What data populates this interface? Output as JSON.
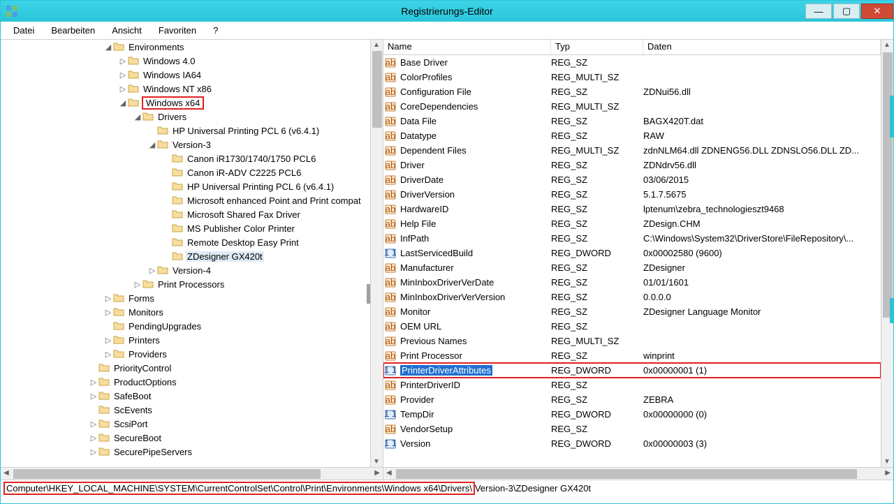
{
  "window": {
    "title": "Registrierungs-Editor"
  },
  "menu": {
    "file": "Datei",
    "edit": "Bearbeiten",
    "view": "Ansicht",
    "favorites": "Favoriten",
    "help": "?"
  },
  "tree": [
    {
      "indent": 7,
      "tw": "◢",
      "label": "Environments"
    },
    {
      "indent": 8,
      "tw": "▷",
      "label": "Windows 4.0"
    },
    {
      "indent": 8,
      "tw": "▷",
      "label": "Windows IA64"
    },
    {
      "indent": 8,
      "tw": "▷",
      "label": "Windows NT x86"
    },
    {
      "indent": 8,
      "tw": "◢",
      "label": "Windows x64",
      "highlight": true
    },
    {
      "indent": 9,
      "tw": "◢",
      "label": "Drivers"
    },
    {
      "indent": 10,
      "tw": "",
      "label": "HP Universal Printing PCL 6 (v6.4.1)"
    },
    {
      "indent": 10,
      "tw": "◢",
      "label": "Version-3"
    },
    {
      "indent": 11,
      "tw": "",
      "label": "Canon iR1730/1740/1750 PCL6"
    },
    {
      "indent": 11,
      "tw": "",
      "label": "Canon iR-ADV C2225 PCL6"
    },
    {
      "indent": 11,
      "tw": "",
      "label": "HP Universal Printing PCL 6 (v6.4.1)"
    },
    {
      "indent": 11,
      "tw": "",
      "label": "Microsoft enhanced Point and Print compat"
    },
    {
      "indent": 11,
      "tw": "",
      "label": "Microsoft Shared Fax Driver"
    },
    {
      "indent": 11,
      "tw": "",
      "label": "MS Publisher Color Printer"
    },
    {
      "indent": 11,
      "tw": "",
      "label": "Remote Desktop Easy Print"
    },
    {
      "indent": 11,
      "tw": "",
      "label": "ZDesigner GX420t",
      "selected": true
    },
    {
      "indent": 10,
      "tw": "▷",
      "label": "Version-4"
    },
    {
      "indent": 9,
      "tw": "▷",
      "label": "Print Processors"
    },
    {
      "indent": 7,
      "tw": "▷",
      "label": "Forms"
    },
    {
      "indent": 7,
      "tw": "▷",
      "label": "Monitors"
    },
    {
      "indent": 7,
      "tw": "",
      "label": "PendingUpgrades"
    },
    {
      "indent": 7,
      "tw": "▷",
      "label": "Printers"
    },
    {
      "indent": 7,
      "tw": "▷",
      "label": "Providers"
    },
    {
      "indent": 6,
      "tw": "",
      "label": "PriorityControl"
    },
    {
      "indent": 6,
      "tw": "▷",
      "label": "ProductOptions"
    },
    {
      "indent": 6,
      "tw": "▷",
      "label": "SafeBoot"
    },
    {
      "indent": 6,
      "tw": "",
      "label": "ScEvents"
    },
    {
      "indent": 6,
      "tw": "▷",
      "label": "ScsiPort"
    },
    {
      "indent": 6,
      "tw": "▷",
      "label": "SecureBoot"
    },
    {
      "indent": 6,
      "tw": "▷",
      "label": "SecurePipeServers"
    }
  ],
  "list": {
    "columns": {
      "name": "Name",
      "type": "Typ",
      "data": "Daten"
    },
    "rows": [
      {
        "icon": "sz",
        "name": "Base Driver",
        "type": "REG_SZ",
        "data": ""
      },
      {
        "icon": "sz",
        "name": "ColorProfiles",
        "type": "REG_MULTI_SZ",
        "data": ""
      },
      {
        "icon": "sz",
        "name": "Configuration File",
        "type": "REG_SZ",
        "data": "ZDNui56.dll"
      },
      {
        "icon": "sz",
        "name": "CoreDependencies",
        "type": "REG_MULTI_SZ",
        "data": ""
      },
      {
        "icon": "sz",
        "name": "Data File",
        "type": "REG_SZ",
        "data": "BAGX420T.dat"
      },
      {
        "icon": "sz",
        "name": "Datatype",
        "type": "REG_SZ",
        "data": "RAW"
      },
      {
        "icon": "sz",
        "name": "Dependent Files",
        "type": "REG_MULTI_SZ",
        "data": "zdnNLM64.dll ZDNENG56.DLL ZDNSLO56.DLL ZD..."
      },
      {
        "icon": "sz",
        "name": "Driver",
        "type": "REG_SZ",
        "data": "ZDNdrv56.dll"
      },
      {
        "icon": "sz",
        "name": "DriverDate",
        "type": "REG_SZ",
        "data": "03/06/2015"
      },
      {
        "icon": "sz",
        "name": "DriverVersion",
        "type": "REG_SZ",
        "data": "5.1.7.5675"
      },
      {
        "icon": "sz",
        "name": "HardwareID",
        "type": "REG_SZ",
        "data": "lptenum\\zebra_technologieszt9468"
      },
      {
        "icon": "sz",
        "name": "Help File",
        "type": "REG_SZ",
        "data": "ZDesign.CHM"
      },
      {
        "icon": "sz",
        "name": "InfPath",
        "type": "REG_SZ",
        "data": "C:\\Windows\\System32\\DriverStore\\FileRepository\\..."
      },
      {
        "icon": "dw",
        "name": "LastServicedBuild",
        "type": "REG_DWORD",
        "data": "0x00002580 (9600)"
      },
      {
        "icon": "sz",
        "name": "Manufacturer",
        "type": "REG_SZ",
        "data": "ZDesigner"
      },
      {
        "icon": "sz",
        "name": "MinInboxDriverVerDate",
        "type": "REG_SZ",
        "data": "01/01/1601"
      },
      {
        "icon": "sz",
        "name": "MinInboxDriverVerVersion",
        "type": "REG_SZ",
        "data": "0.0.0.0"
      },
      {
        "icon": "sz",
        "name": "Monitor",
        "type": "REG_SZ",
        "data": "ZDesigner Language Monitor"
      },
      {
        "icon": "sz",
        "name": "OEM URL",
        "type": "REG_SZ",
        "data": ""
      },
      {
        "icon": "sz",
        "name": "Previous Names",
        "type": "REG_MULTI_SZ",
        "data": ""
      },
      {
        "icon": "sz",
        "name": "Print Processor",
        "type": "REG_SZ",
        "data": "winprint"
      },
      {
        "icon": "dw",
        "name": "PrinterDriverAttributes",
        "type": "REG_DWORD",
        "data": "0x00000001 (1)",
        "selected": true,
        "highlight": true
      },
      {
        "icon": "sz",
        "name": "PrinterDriverID",
        "type": "REG_SZ",
        "data": ""
      },
      {
        "icon": "sz",
        "name": "Provider",
        "type": "REG_SZ",
        "data": "ZEBRA"
      },
      {
        "icon": "dw",
        "name": "TempDir",
        "type": "REG_DWORD",
        "data": "0x00000000 (0)"
      },
      {
        "icon": "sz",
        "name": "VendorSetup",
        "type": "REG_SZ",
        "data": ""
      },
      {
        "icon": "dw",
        "name": "Version",
        "type": "REG_DWORD",
        "data": "0x00000003 (3)"
      }
    ]
  },
  "status": {
    "boxed": "Computer\\HKEY_LOCAL_MACHINE\\SYSTEM\\CurrentControlSet\\Control\\Print\\Environments\\Windows x64\\Drivers\\",
    "rest": "Version-3\\ZDesigner GX420t"
  }
}
